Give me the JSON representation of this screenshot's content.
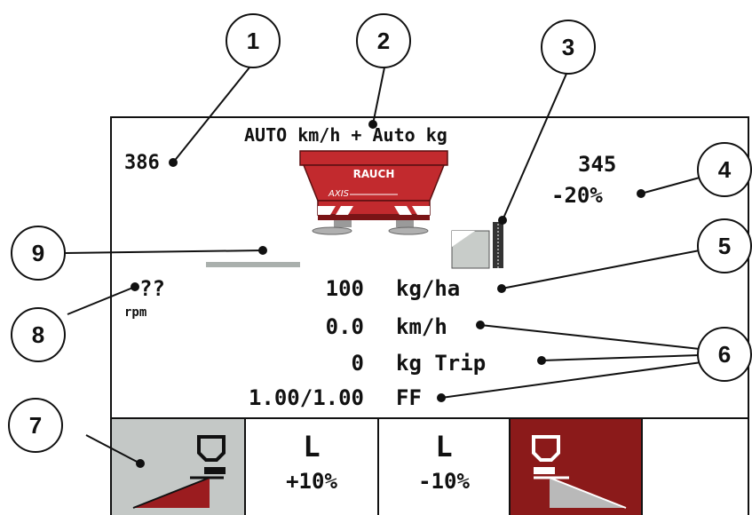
{
  "header": {
    "mode_title": "AUTO km/h + Auto kg"
  },
  "left_value": "386",
  "right_value": "345",
  "right_percent": "-20%",
  "spreader": {
    "brand": "RAUCH",
    "model": "AXIS"
  },
  "rpm": {
    "value": "??",
    "unit": "rpm"
  },
  "rows": [
    {
      "value": "100",
      "unit": "kg/ha"
    },
    {
      "value": "0.0",
      "unit": "km/h"
    },
    {
      "value": "0",
      "unit": "kg Trip"
    },
    {
      "value": "1.00/1.00",
      "unit": "FF"
    }
  ],
  "buttons": {
    "left_minus": {
      "top": "L",
      "bottom": "+10%"
    },
    "left_plus": {
      "top": "L",
      "bottom": "-10%"
    }
  },
  "callouts": [
    "1",
    "2",
    "3",
    "4",
    "5",
    "6",
    "7",
    "8",
    "9"
  ],
  "colors": {
    "accent_red": "#8b1a1a",
    "button_gray": "#c4c8c6",
    "spreader_red": "#c22a2e"
  },
  "icons": [
    "left-spread-icon",
    "right-spread-icon",
    "border-spread-icon",
    "spreader-machine-icon"
  ]
}
